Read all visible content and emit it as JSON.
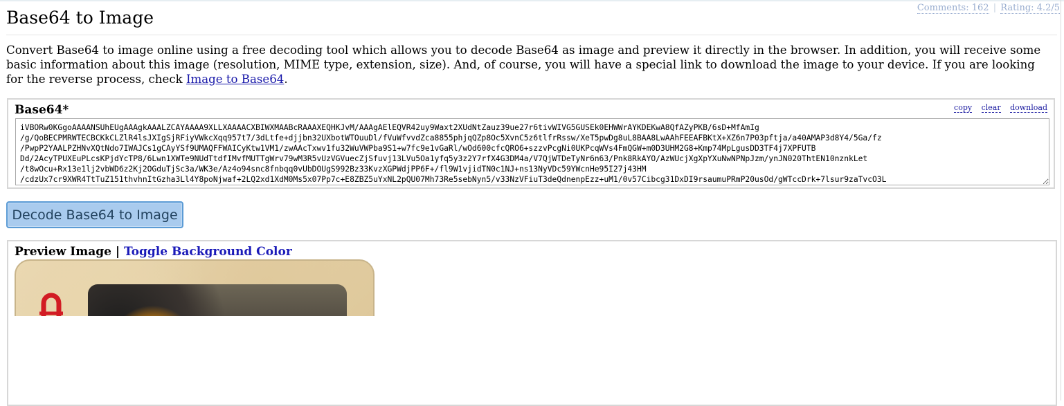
{
  "header": {
    "comments": "Comments: 162",
    "separator": "|",
    "rating": "Rating: 4.2/5"
  },
  "page": {
    "title": "Base64 to Image",
    "intro_text": "Convert Base64 to image online using a free decoding tool which allows you to decode Base64 as image and preview it directly in the browser. In addition, you will receive some basic information about this image (resolution, MIME type, extension, size). And, of course, you will have a special link to download the image to your device. If you are looking for the reverse process, check ",
    "intro_link": "Image to Base64",
    "intro_end": "."
  },
  "input_box": {
    "label": "Base64*",
    "tools": [
      "copy",
      "clear",
      "download"
    ],
    "value": "iVBORw0KGgoAAAANSUhEUgAAAgkAAALZCAYAAAA9XLLXAAAACXBIWXMAABcRAAAXEQHKJvM/AAAgAElEQVR42uy9Waxt2XUdNtZauz39ue27r6tivWIVG5GUSEk0EHWWrAYKDEKwA8QfAZyPKB/6sD+MfAmIg\n/g/QoBECPMRWTECBCKkCLZlR4lsJXIgSjRFiyVWkcXqq957t7/3dLtfe+djjbn32UXbotWTOuuDl/fVuWfvvdZca8855phjqQZp8Oc5XvnC5z6tlfrRssw/XeT5pwDg8uL8BAA8LwAAhFEEAFBKtX+XZ6n7P03pftja/a40AMAP3d8Y4/5Ga/fz\n/PwpP2YAALPZHNvXQtNdo7IWAJCs1gCAyYSf9UMAQFFWAICyKtw1VM1/zwAAcTxwv1fu32WuVWPba9S1+w7fc9e1vGaRl/wOd600cfcQRO6+szzvPcgNi0UKPcqWVs4FmQGW+m0D3UHM2G8+Kmp74MpLgusDD3TF4j7XPFUTB\nDd/2AcyTPUXEuPLcsKPjdYcTP8/6Lwn1XWTe9NUdTtdfIMvfMUTTgWrv79wM3R5vUzVGVuecZjSfuvj13LVu5Oa1yfq5y3z2Y7rfX4G3DM4a/V7QjWTDeTyNr6n63/Pnk8RkAYO/AzWUcjXgXpYXuNwNPNpJzm/ynJN020ThtEN10nznkLet\n/t8wOcu+Rx13e1lj2vbWD6z2Kj2OGduTjSc3a/WK3e/Az4o94snc8fnbqq0vUbDOUgS992Bz33KvzXGPWdjPP6F+/fl9W1vjidTN0c1NJ+ns13NyVDc59YWcnHe95I27j43HM\n/cdzUx7cr9XWR4TtTuZ151thvhnItGzha3Ll4Y8poNjwaf+2LQ2xd1XdM0Ms5x07Pp7c+E8ZBZ5uYxNL2pQU07Mh73Re5sebNyn5/v33NzVFiuT3deQdnenpEzz+uM1/0v57Cibcg31DxDI9rsaumuPRmP20usOd/gWTccDrk+7lsur9zaTvcO3L"
  },
  "actions": {
    "decode_label": "Decode Base64 to Image"
  },
  "preview": {
    "title": "Preview Image",
    "separator": " | ",
    "toggle_label": "Toggle Background Color"
  }
}
